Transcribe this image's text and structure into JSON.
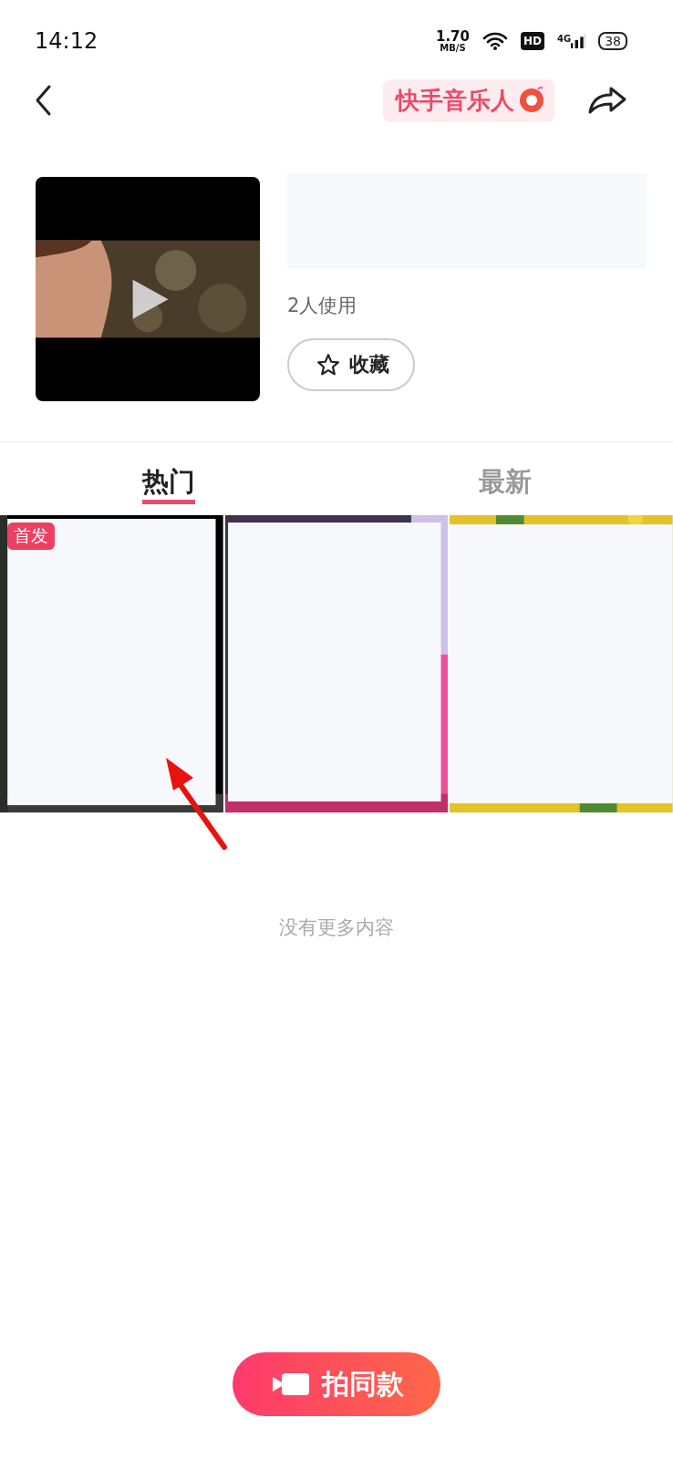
{
  "status_bar": {
    "time": "14:12",
    "speed": "1.70",
    "speed_unit": "MB/S",
    "hd": "HD",
    "network": "4G",
    "battery": "38"
  },
  "nav": {
    "badge": "快手音乐人"
  },
  "music": {
    "usage": "2人使用",
    "favorite_button": "收藏"
  },
  "tabs": [
    {
      "label": "热门",
      "selected": true
    },
    {
      "label": "最新",
      "selected": false
    }
  ],
  "videos": [
    {
      "kind": "dark",
      "badge": "首发"
    },
    {
      "kind": "pink"
    },
    {
      "kind": "flowers"
    }
  ],
  "annotation": {
    "kind": "arrow"
  },
  "footer": "没有更多内容",
  "shoot_button": "拍同款"
}
